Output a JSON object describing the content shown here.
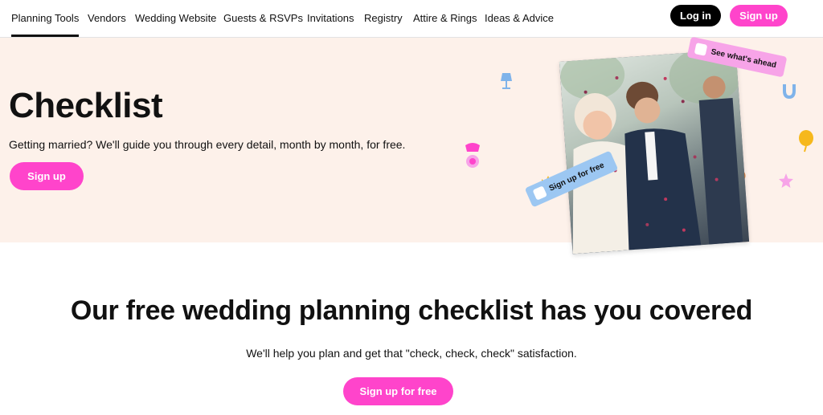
{
  "nav": {
    "items": [
      {
        "label": "Planning Tools"
      },
      {
        "label": "Vendors"
      },
      {
        "label": "Wedding Website"
      },
      {
        "label": "Guests & RSVPs"
      },
      {
        "label": "Invitations"
      },
      {
        "label": "Registry"
      },
      {
        "label": "Attire & Rings"
      },
      {
        "label": "Ideas & Advice"
      }
    ],
    "login_label": "Log in",
    "signup_label": "Sign up"
  },
  "hero": {
    "title": "Checklist",
    "subtitle": "Getting married? We'll guide you through every detail, month by month, for free.",
    "signup_label": "Sign up",
    "tag_ahead": "See what's ahead",
    "tag_signup": "Sign up for free"
  },
  "section": {
    "title": "Our free wedding planning checklist has you covered",
    "subtitle": "We'll help you plan and get that \"check, check, check\" satisfaction.",
    "button_label": "Sign up for free"
  },
  "colors": {
    "brand_pink": "#ff44cb",
    "hero_bg": "#fdf1ea",
    "tag_blue": "#9cc7f2",
    "tag_pink": "#f7a4e8"
  }
}
